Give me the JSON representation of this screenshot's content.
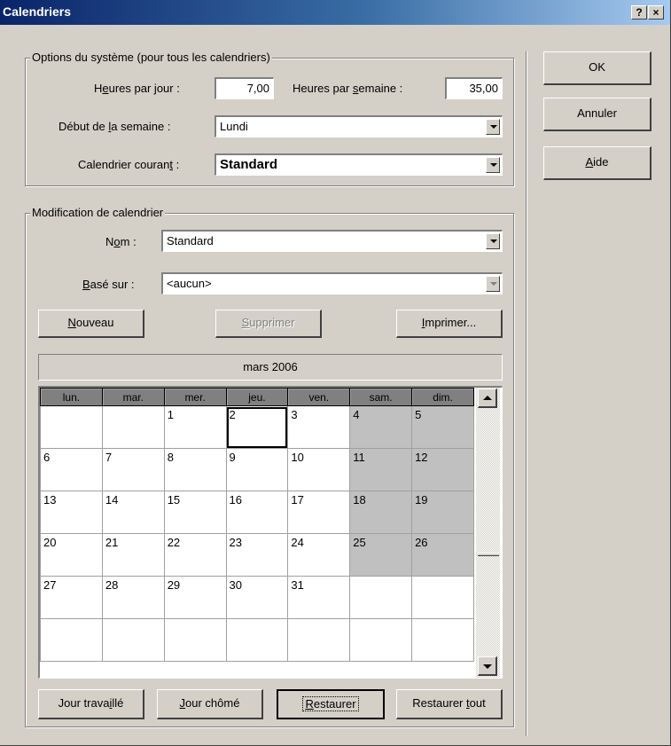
{
  "window": {
    "title": "Calendriers",
    "help_btn": "?",
    "close_btn": "×"
  },
  "system_options": {
    "legend": "Options du système (pour tous les calendriers)",
    "hours_per_day": {
      "label_pre": "H",
      "label_u": "e",
      "label_post": "ures par jour :",
      "value": "7,00"
    },
    "hours_per_week": {
      "label_pre": "Heures par ",
      "label_u": "s",
      "label_post": "emaine :",
      "value": "35,00"
    },
    "week_start": {
      "label_pre": "Début de ",
      "label_u": "l",
      "label_post": "a semaine :",
      "value": "Lundi"
    },
    "current_calendar": {
      "label_pre": "Calendrier couran",
      "label_u": "t",
      "label_post": " :",
      "value": "Standard"
    }
  },
  "calendar_edit": {
    "legend": "Modification de calendrier",
    "name": {
      "label_pre": "N",
      "label_u": "o",
      "label_post": "m :",
      "value": "Standard"
    },
    "based_on": {
      "label_pre": "",
      "label_u": "B",
      "label_post": "asé sur :",
      "value": "<aucun>"
    },
    "new_btn": {
      "u": "N",
      "rest": "ouveau"
    },
    "delete_btn": {
      "u": "S",
      "rest": "upprimer"
    },
    "print_btn": {
      "u": "I",
      "rest": "mprimer..."
    }
  },
  "month_title": "mars  2006",
  "calendar": {
    "headers": [
      "lun.",
      "mar.",
      "mer.",
      "jeu.",
      "ven.",
      "sam.",
      "dim."
    ],
    "rows": [
      [
        "",
        "",
        "1",
        "2",
        "3",
        "4",
        "5"
      ],
      [
        "6",
        "7",
        "8",
        "9",
        "10",
        "11",
        "12"
      ],
      [
        "13",
        "14",
        "15",
        "16",
        "17",
        "18",
        "19"
      ],
      [
        "20",
        "21",
        "22",
        "23",
        "24",
        "25",
        "26"
      ],
      [
        "27",
        "28",
        "29",
        "30",
        "31",
        "",
        ""
      ],
      [
        "",
        "",
        "",
        "",
        "",
        "",
        ""
      ]
    ],
    "selected_day": "2",
    "nonworking_color": "#c0c0c0"
  },
  "bottom_buttons": {
    "working_day": {
      "pre": "Jour trava",
      "u": "i",
      "post": "llé"
    },
    "nonworking_day": {
      "pre": "",
      "u": "J",
      "post": "our chômé"
    },
    "restore": {
      "pre": "",
      "u": "R",
      "post": "estaurer"
    },
    "restore_all": {
      "pre": "Restaurer ",
      "u": "t",
      "post": "out"
    }
  },
  "side_buttons": {
    "ok": "OK",
    "cancel": "Annuler",
    "help": {
      "u": "A",
      "rest": "ide"
    }
  },
  "colors": {
    "face": "#d4d0c8",
    "title_start": "#0a246a",
    "title_end": "#a6caf0"
  }
}
